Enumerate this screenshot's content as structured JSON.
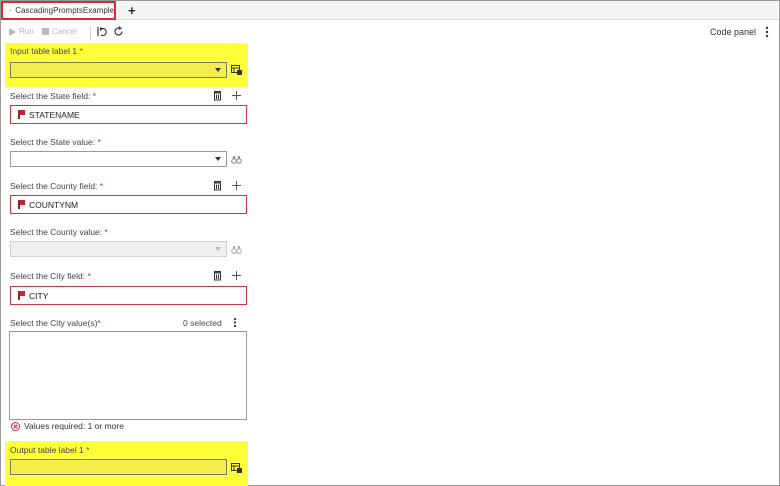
{
  "tab": {
    "title": "CascadingPromptsExample",
    "add_label": "+"
  },
  "toolbar": {
    "run_label": "Run",
    "cancel_label": "Cancel",
    "code_panel_label": "Code panel"
  },
  "form": {
    "input_table": {
      "label": "Input table label 1",
      "required_mark": "*",
      "value": ""
    },
    "state_field": {
      "label": "Select the State field:",
      "required_mark": "*",
      "value": "STATENAME"
    },
    "state_value": {
      "label": "Select the State value:",
      "required_mark": "*",
      "value": ""
    },
    "county_field": {
      "label": "Select the County field:",
      "required_mark": "*",
      "value": "COUNTYNM"
    },
    "county_value": {
      "label": "Select the County value:",
      "required_mark": "*",
      "value": ""
    },
    "city_field": {
      "label": "Select the City field:",
      "required_mark": "*",
      "value": "CITY"
    },
    "city_values": {
      "label": "Select the City value(s)",
      "required_mark": "*",
      "selected_count": "0 selected",
      "validation": "Values required: 1 or more"
    },
    "output_table": {
      "label": "Output table label 1",
      "required_mark": "*",
      "value": ""
    }
  },
  "colors": {
    "highlight": "#ffff3a",
    "required": "#c4262e",
    "tab_border": "#e0282f"
  }
}
